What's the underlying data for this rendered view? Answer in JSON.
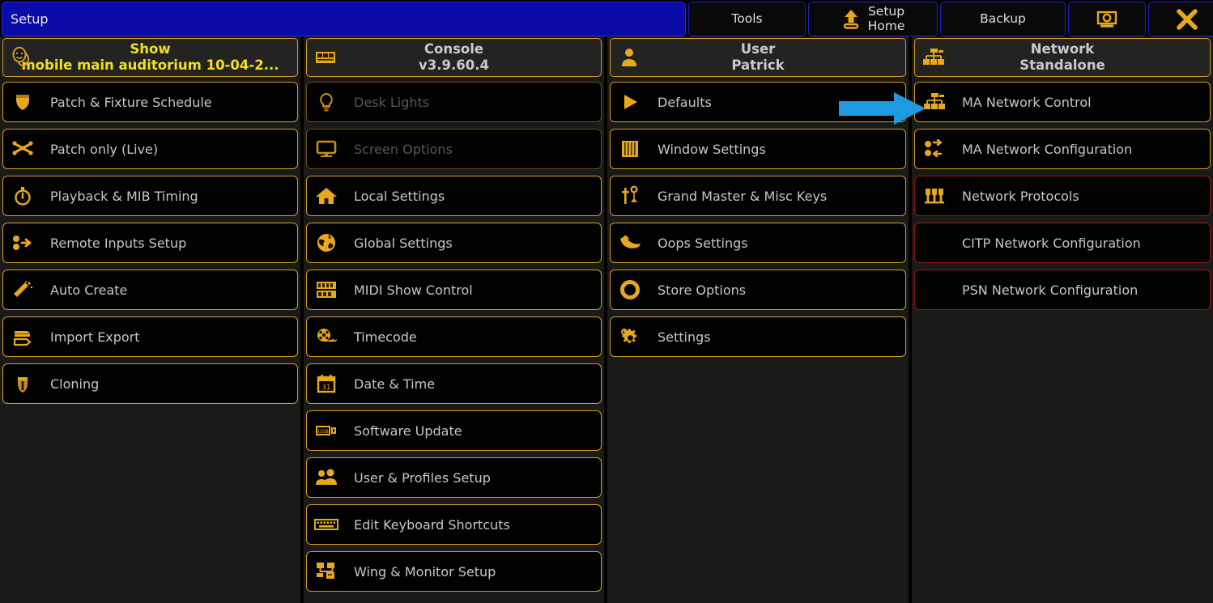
{
  "titlebar": {
    "title": "Setup",
    "buttons": [
      {
        "name": "tools",
        "label": "Tools"
      },
      {
        "name": "setup-home",
        "label_line1": "Setup",
        "label_line2": "Home",
        "icon": "up-arrow-home-icon"
      },
      {
        "name": "backup",
        "label": "Backup"
      },
      {
        "name": "screenshot",
        "icon": "camera-icon"
      },
      {
        "name": "close",
        "icon": "close-x-icon"
      }
    ]
  },
  "colors": {
    "accent_orange": "#D59B22",
    "icon_gold": "#E8A81E",
    "title_blue": "#0B0BA8",
    "border_blue": "#2121C8",
    "disabled_border": "#6A4E12",
    "disabled_text": "#56565C",
    "red_border": "#9A1414",
    "text_gray": "#C5C5CE",
    "header_yellow": "#F2E11A",
    "panel_bg": "#1A1A18",
    "button_bg": "#020202",
    "arrow_blue": "#1E9BE0"
  },
  "columns": [
    {
      "id": "show",
      "icon": "theatre-masks-icon",
      "heading": "Show",
      "subheading": "mobile main auditorium 10-04-2...",
      "yellow_heading": true,
      "items": [
        {
          "label": "Patch & Fixture Schedule",
          "icon": "shield-patch-icon",
          "state": "normal"
        },
        {
          "label": "Patch only (Live)",
          "icon": "bowtie-patch-icon",
          "state": "normal"
        },
        {
          "label": "Playback & MIB Timing",
          "icon": "stopwatch-icon",
          "state": "normal"
        },
        {
          "label": "Remote Inputs Setup",
          "icon": "remote-inputs-icon",
          "state": "normal"
        },
        {
          "label": "Auto Create",
          "icon": "magic-wand-icon",
          "state": "normal"
        },
        {
          "label": "Import Export",
          "icon": "import-export-icon",
          "state": "normal"
        },
        {
          "label": "Cloning",
          "icon": "cloning-icon",
          "state": "normal"
        }
      ]
    },
    {
      "id": "console",
      "icon": "console-desk-icon",
      "heading": "Console",
      "subheading": "v3.9.60.4",
      "yellow_heading": false,
      "items": [
        {
          "label": "Desk Lights",
          "icon": "lightbulb-icon",
          "state": "disabled"
        },
        {
          "label": "Screen Options",
          "icon": "monitor-icon",
          "state": "disabled"
        },
        {
          "label": "Local Settings",
          "icon": "house-icon",
          "state": "normal"
        },
        {
          "label": "Global Settings",
          "icon": "globe-icon",
          "state": "normal"
        },
        {
          "label": "MIDI Show Control",
          "icon": "midi-icon",
          "state": "normal"
        },
        {
          "label": "Timecode",
          "icon": "film-reel-icon",
          "state": "normal"
        },
        {
          "label": "Date & Time",
          "icon": "calendar-icon",
          "state": "normal"
        },
        {
          "label": "Software Update",
          "icon": "usb-stick-icon",
          "state": "normal"
        },
        {
          "label": "User & Profiles Setup",
          "icon": "users-icon",
          "state": "normal"
        },
        {
          "label": "Edit Keyboard Shortcuts",
          "icon": "keyboard-icon",
          "state": "normal"
        },
        {
          "label": "Wing & Monitor Setup",
          "icon": "wing-monitor-icon",
          "state": "normal"
        }
      ]
    },
    {
      "id": "user",
      "icon": "user-person-icon",
      "heading": "User",
      "subheading": "Patrick",
      "yellow_heading": false,
      "items": [
        {
          "label": "Defaults",
          "icon": "play-triangle-icon",
          "state": "normal"
        },
        {
          "label": "Window Settings",
          "icon": "window-columns-icon",
          "state": "normal"
        },
        {
          "label": "Grand Master & Misc Keys",
          "icon": "faders-keys-icon",
          "state": "normal"
        },
        {
          "label": "Oops Settings",
          "icon": "undo-arrow-icon",
          "state": "normal"
        },
        {
          "label": "Store Options",
          "icon": "store-ring-icon",
          "state": "normal"
        },
        {
          "label": "Settings",
          "icon": "gear-icon",
          "state": "normal"
        }
      ]
    },
    {
      "id": "network",
      "icon": "network-tree-icon",
      "heading": "Network",
      "subheading": "Standalone",
      "yellow_heading": false,
      "items": [
        {
          "label": "MA Network Control",
          "icon": "network-tree-icon",
          "state": "normal"
        },
        {
          "label": "MA Network Configuration",
          "icon": "network-config-icon",
          "state": "normal"
        },
        {
          "label": "Network Protocols",
          "icon": "protocols-icon",
          "state": "red"
        },
        {
          "label": "CITP Network Configuration",
          "icon": "none",
          "state": "red"
        },
        {
          "label": "PSN Network Configuration",
          "icon": "none",
          "state": "red"
        }
      ]
    }
  ],
  "annotation": {
    "type": "arrow",
    "direction": "right",
    "color": "#1E9BE0",
    "points_to": "MA Network Control"
  }
}
